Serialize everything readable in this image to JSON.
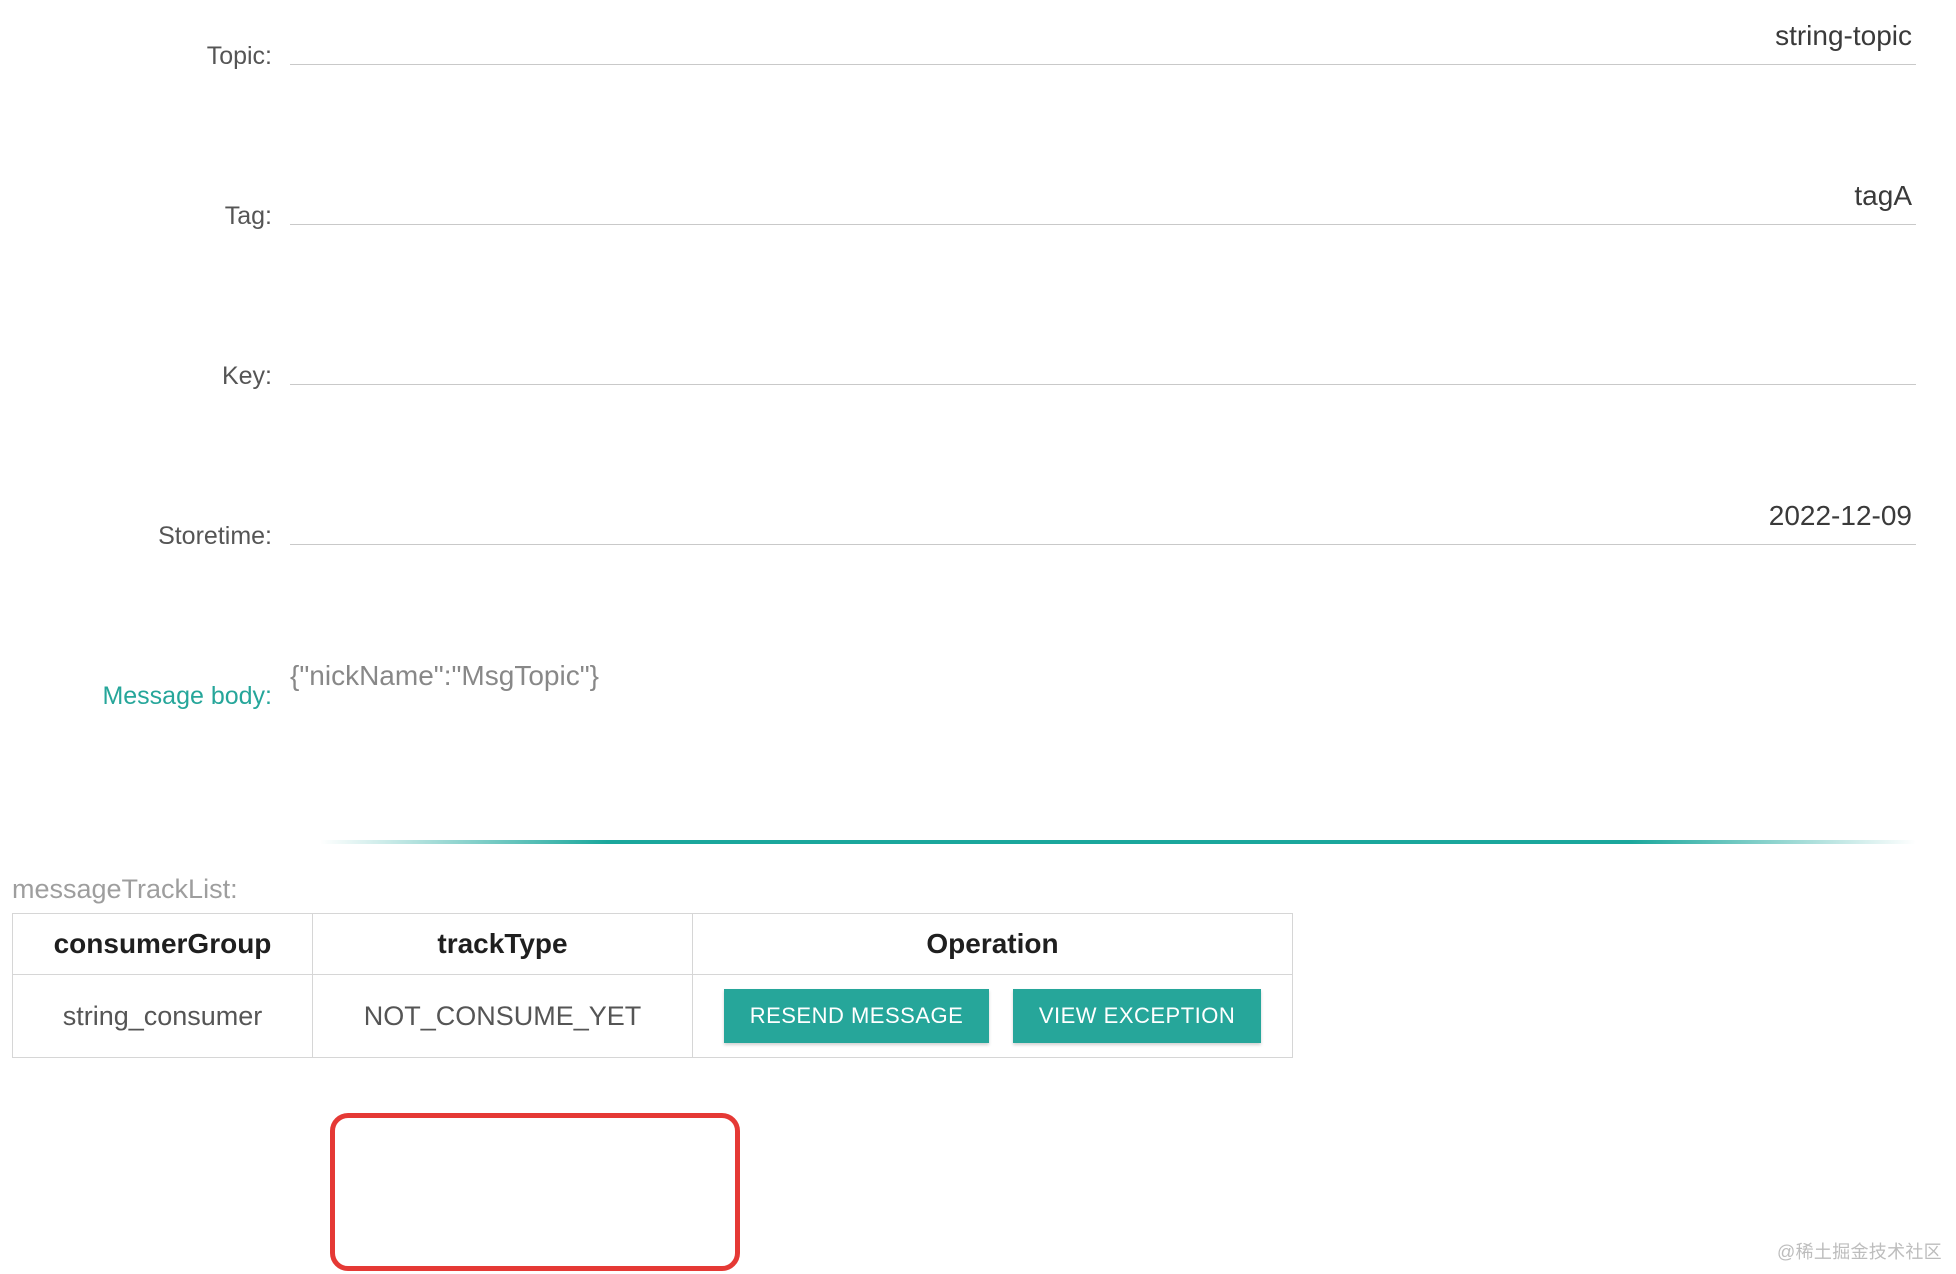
{
  "fields": {
    "topic": {
      "label": "Topic:",
      "value": "string-topic"
    },
    "tag": {
      "label": "Tag:",
      "value": "tagA"
    },
    "key": {
      "label": "Key:",
      "value": ""
    },
    "storetime": {
      "label": "Storetime:",
      "value": "2022-12-09"
    },
    "messageBody": {
      "label": "Message body:",
      "value": "{\"nickName\":\"MsgTopic\"}"
    }
  },
  "trackList": {
    "label": "messageTrackList:",
    "headers": {
      "consumerGroup": "consumerGroup",
      "trackType": "trackType",
      "operation": "Operation"
    },
    "row": {
      "consumerGroup": "string_consumer",
      "trackType": "NOT_CONSUME_YET"
    },
    "buttons": {
      "resend": "RESEND MESSAGE",
      "viewException": "VIEW EXCEPTION"
    }
  },
  "watermark": "@稀土掘金技术社区"
}
